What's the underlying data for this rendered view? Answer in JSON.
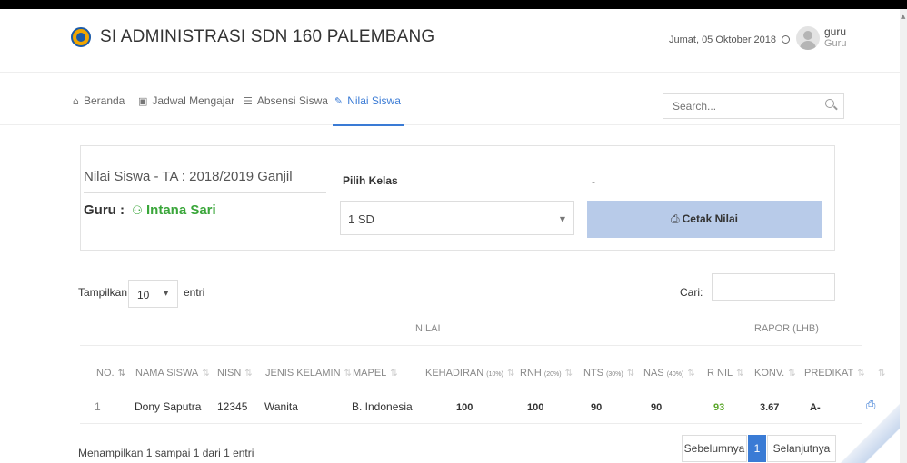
{
  "app": {
    "title": "SI ADMINISTRASI SDN 160 PALEMBANG",
    "date": "Jumat, 05 Oktober 2018",
    "user_name": "guru",
    "user_role": "Guru"
  },
  "nav": {
    "items": [
      {
        "label": "Beranda",
        "icon": "home-icon"
      },
      {
        "label": "Jadwal Mengajar",
        "icon": "calendar-icon"
      },
      {
        "label": "Absensi Siswa",
        "icon": "database-icon"
      },
      {
        "label": "Nilai Siswa",
        "icon": "grades-icon",
        "active": true
      }
    ],
    "search_placeholder": "Search..."
  },
  "panel": {
    "title": "Nilai Siswa - TA : 2018/2019 Ganjil",
    "guru_label": "Guru :",
    "guru_name": "Intana Sari",
    "kelas_label": "Pilih Kelas",
    "kelas_value": "1 SD",
    "dash": "-",
    "cetak_label": "Cetak Nilai"
  },
  "table_controls": {
    "show_label": "Tampilkan",
    "show_value": "10",
    "entri_label": "entri",
    "cari_label": "Cari:"
  },
  "table": {
    "group_nilai": "NILAI",
    "group_rapor": "RAPOR (LHB)",
    "headers": {
      "no": "NO.",
      "nama": "NAMA SISWA",
      "nisn": "NISN",
      "jk": "JENIS KELAMIN",
      "mapel": "MAPEL",
      "kehadiran": "KEHADIRAN",
      "kehadiran_pct": "(10%)",
      "rnh": "RNH",
      "rnh_pct": "(20%)",
      "nts": "NTS",
      "nts_pct": "(30%)",
      "nas": "NAS",
      "nas_pct": "(40%)",
      "rnil": "R NIL",
      "konv": "KONV.",
      "predikat": "PREDIKAT"
    },
    "rows": [
      {
        "no": "1",
        "nama": "Dony Saputra",
        "nisn": "12345",
        "jk": "Wanita",
        "mapel": "B. Indonesia",
        "kehadiran": "100",
        "rnh": "100",
        "nts": "90",
        "nas": "90",
        "rnil": "93",
        "konv": "3.67",
        "predikat": "A-"
      }
    ]
  },
  "footer": {
    "info": "Menampilkan 1 sampai 1 dari 1 entri",
    "prev": "Sebelumnya",
    "page": "1",
    "next": "Selanjutnya"
  },
  "colors": {
    "accent": "#3a7bd5",
    "green": "#3aa63a",
    "button": "#b8cbe9"
  }
}
